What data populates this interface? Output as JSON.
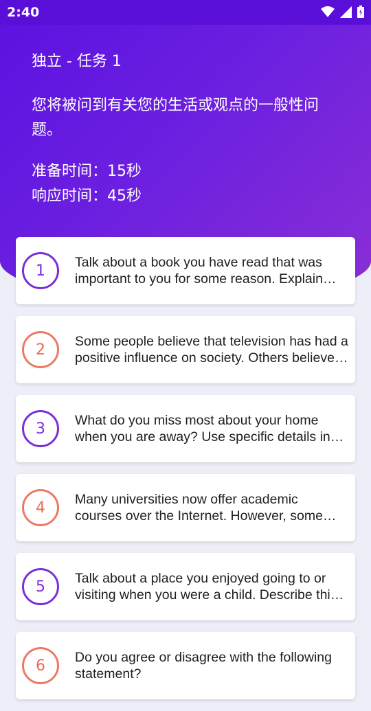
{
  "status_bar": {
    "time": "2:40"
  },
  "header": {
    "title": "独立 - 任务 1",
    "description": "您将被问到有关您的生活或观点的一般性问题。",
    "prep_time": "准备时间：15秒",
    "response_time": "响应时间：45秒"
  },
  "questions": [
    {
      "number": "1",
      "text": "Talk about a book you have read that was important to you for some reason. Explain why the book was important to you."
    },
    {
      "number": "2",
      "text": "Some people believe that television has had a positive influence on society. Others believe it has had a negative influence."
    },
    {
      "number": "3",
      "text": "What do you miss most about your home when you are away? Use specific details in your explanation."
    },
    {
      "number": "4",
      "text": "Many universities now offer academic courses over the Internet. However, some people believe that it is better to take courses in a traditional classroom."
    },
    {
      "number": "5",
      "text": "Talk about a place you enjoyed going to or visiting when you were a child. Describe this place and explain why it was special."
    },
    {
      "number": "6",
      "text": "Do you agree or disagree with the following statement?"
    }
  ],
  "colors": {
    "purple": "#7b2fd8",
    "orange": "#ec6a52",
    "header_gradient_start": "#5b12e0",
    "header_gradient_end": "#8a2fd6"
  }
}
